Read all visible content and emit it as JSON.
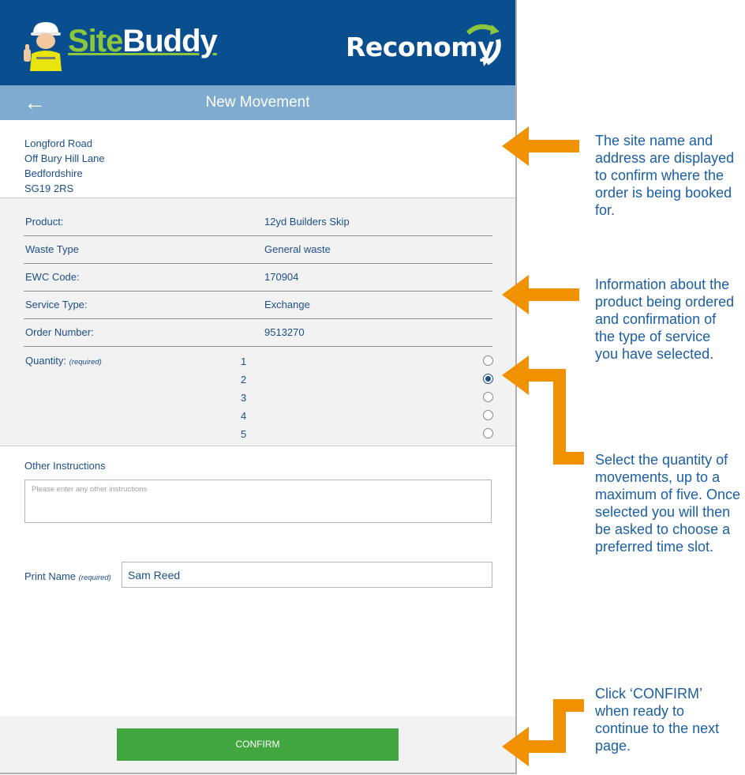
{
  "app": {
    "brand_left_a": "Site",
    "brand_left_b": "Buddy",
    "brand_right": "Reconomy"
  },
  "nav": {
    "back_icon": "←",
    "title": "New Movement"
  },
  "address": [
    "Longford Road",
    "Off Bury Hill Lane",
    "Bedfordshire",
    "SG19 2RS"
  ],
  "details": [
    {
      "label": "Product:",
      "value": "12yd Builders Skip"
    },
    {
      "label": "Waste Type",
      "value": "General waste"
    },
    {
      "label": "EWC Code:",
      "value": "170904"
    },
    {
      "label": "Service Type:",
      "value": "Exchange"
    },
    {
      "label": "Order Number:",
      "value": "9513270"
    }
  ],
  "quantity": {
    "label": "Quantity:",
    "required": "(required)",
    "options": [
      "1",
      "2",
      "3",
      "4",
      "5"
    ],
    "selected": "2"
  },
  "other_instructions": {
    "label": "Other Instructions",
    "placeholder": "Please enter any other instructions",
    "value": ""
  },
  "print_name": {
    "label": "Print Name",
    "required": "(required)",
    "value": "Sam Reed"
  },
  "confirm_label": "CONFIRM",
  "annotations": [
    "The site name and address are displayed to confirm where the order is being booked for.",
    "Information about the product being ordered and confirmation of the type of service you have selected.",
    "Select the quantity of movements, up to a maximum of five. Once selected you will then be asked to choose a preferred time slot.",
    "Click ‘CONFIRM’ when ready to continue to the next page."
  ],
  "colors": {
    "header": "#094e8f",
    "navbar": "#7eabcf",
    "text": "#1b4f8a",
    "confirm": "#42a640",
    "arrow": "#f29100",
    "note": "#1b5fa3"
  }
}
